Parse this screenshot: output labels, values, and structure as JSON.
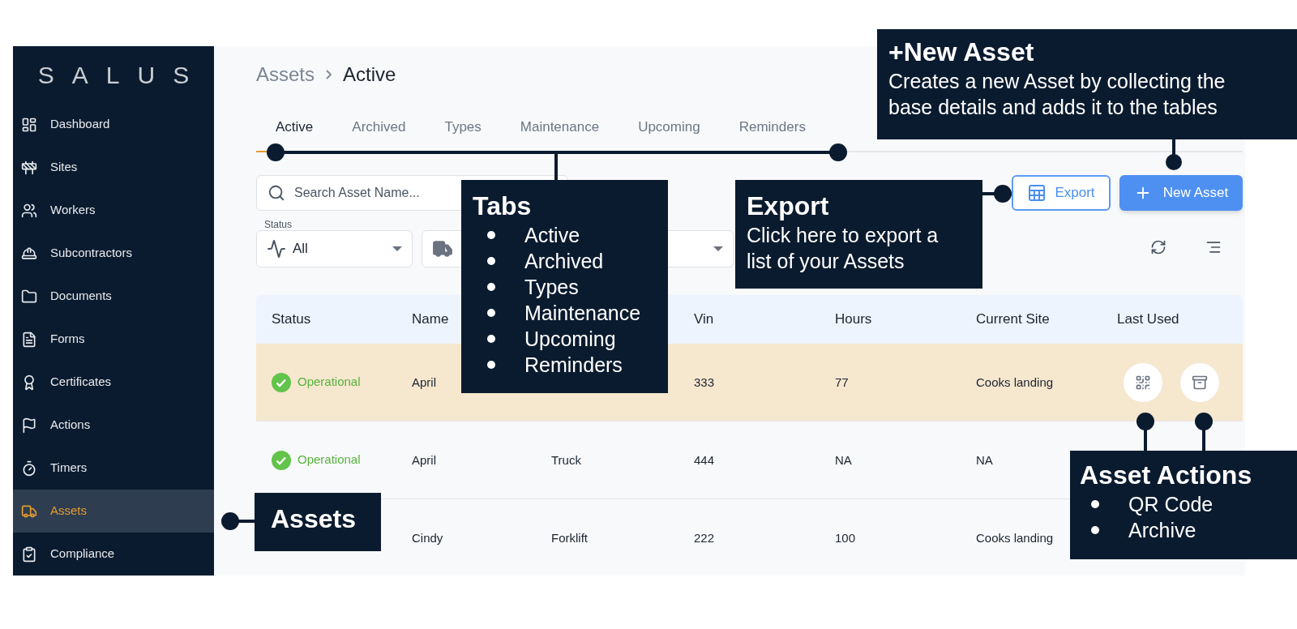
{
  "sidebar": {
    "logo": "SALUS",
    "items": [
      {
        "label": "Dashboard",
        "selected": false
      },
      {
        "label": "Sites",
        "selected": false
      },
      {
        "label": "Workers",
        "selected": false
      },
      {
        "label": "Subcontractors",
        "selected": false
      },
      {
        "label": "Documents",
        "selected": false
      },
      {
        "label": "Forms",
        "selected": false
      },
      {
        "label": "Certificates",
        "selected": false
      },
      {
        "label": "Actions",
        "selected": false
      },
      {
        "label": "Timers",
        "selected": false
      },
      {
        "label": "Assets",
        "selected": true
      },
      {
        "label": "Compliance",
        "selected": false
      }
    ]
  },
  "breadcrumb": {
    "parent": "Assets",
    "current": "Active"
  },
  "tabs": [
    {
      "label": "Active",
      "selected": true
    },
    {
      "label": "Archived",
      "selected": false
    },
    {
      "label": "Types",
      "selected": false
    },
    {
      "label": "Maintenance",
      "selected": false
    },
    {
      "label": "Upcoming",
      "selected": false
    },
    {
      "label": "Reminders",
      "selected": false
    }
  ],
  "search": {
    "placeholder": "Search Asset Name..."
  },
  "filters": [
    {
      "kind": "status",
      "label": "Status",
      "value": "All"
    },
    {
      "kind": "type"
    }
  ],
  "buttons": {
    "export": "Export",
    "new_asset": "New Asset"
  },
  "table": {
    "columns": [
      "Status",
      "Name",
      "Vin",
      "Hours",
      "Current Site",
      "Last Used"
    ],
    "rows": [
      {
        "status": "Operational",
        "name": "April",
        "vin": "333",
        "hours": "77",
        "site": "Cooks landing",
        "highlighted": true,
        "actions": true
      },
      {
        "status": "Operational",
        "name": "April",
        "type": "Truck",
        "vin": "444",
        "hours": "NA",
        "site": "NA",
        "highlighted": false
      },
      {
        "name": "Cindy",
        "type": "Forklift",
        "vin": "222",
        "hours": "100",
        "site": "Cooks landing",
        "highlighted": false
      }
    ]
  },
  "callouts": [
    {
      "kind": "text",
      "title": "+New Asset",
      "lines": [
        "Creates a new Asset by collecting the",
        "base details and adds it to the tables"
      ]
    },
    {
      "kind": "list",
      "title": "Tabs",
      "items": [
        "Active",
        "Archived",
        "Types",
        "Maintenance",
        "Upcoming",
        "Reminders"
      ]
    },
    {
      "kind": "text",
      "title": "Export",
      "lines": [
        "Click here to export a",
        "list of your Assets"
      ]
    },
    {
      "kind": "text",
      "title": "Assets"
    },
    {
      "kind": "list",
      "title": "Asset Actions",
      "items": [
        "QR Code",
        "Archive"
      ]
    }
  ]
}
